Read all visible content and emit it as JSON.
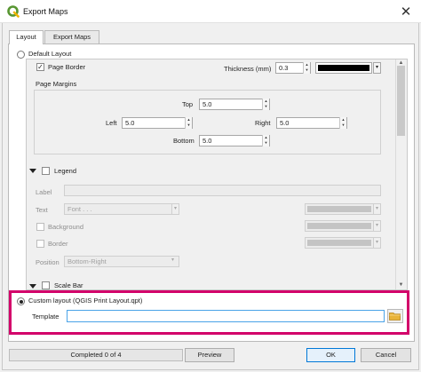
{
  "window": {
    "title": "Export Maps",
    "colors": {
      "accent": "#0078d7",
      "highlight": "#d3006a",
      "input_focus": "#4aa3e8",
      "qgis_green": "#589632"
    }
  },
  "tabs": [
    {
      "label": "Layout",
      "active": true
    },
    {
      "label": "Export Maps",
      "active": false
    }
  ],
  "default_layout": {
    "label": "Default Layout",
    "selected": false
  },
  "page_border": {
    "label": "Page Border",
    "checked": true,
    "thickness_label": "Thickness (mm)",
    "thickness_value": "0.3",
    "color": "#000000"
  },
  "page_margins": {
    "title": "Page Margins",
    "top": {
      "label": "Top",
      "value": "5.0"
    },
    "left": {
      "label": "Left",
      "value": "5.0"
    },
    "right": {
      "label": "Right",
      "value": "5.0"
    },
    "bottom": {
      "label": "Bottom",
      "value": "5.0"
    }
  },
  "legend": {
    "title": "Legend",
    "checked": false,
    "label_label": "Label",
    "text_label": "Text",
    "font_placeholder": "Font . . .",
    "background_label": "Background",
    "border_label": "Border",
    "position_label": "Position",
    "position_value": "Bottom-Right"
  },
  "scale_bar": {
    "title": "Scale Bar",
    "checked": false
  },
  "custom_layout": {
    "label": "Custom layout (QGIS Print Layout.qpt)",
    "selected": true,
    "template_label": "Template",
    "template_value": ""
  },
  "footer": {
    "progress_text": "Completed 0 of 4",
    "preview_label": "Preview",
    "ok_label": "OK",
    "cancel_label": "Cancel"
  },
  "icons": [
    "qgis-logo-icon",
    "close-icon",
    "checkmark-icon",
    "collapse-triangle-icon",
    "spin-up-icon",
    "spin-down-icon",
    "dropdown-arrow-icon",
    "folder-icon"
  ]
}
